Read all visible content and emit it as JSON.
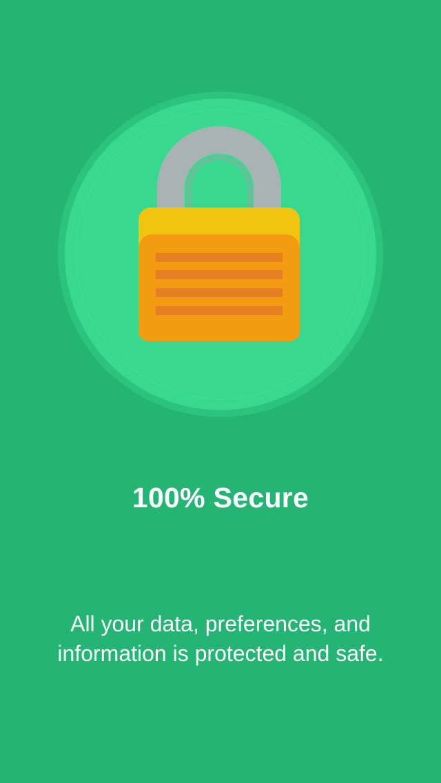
{
  "colors": {
    "background": "#24b574",
    "circle_outer": "#2cc27f",
    "circle_inner": "#38d98e",
    "shackle": "#a9b3b4",
    "lock_top": "#f1c40f",
    "lock_body": "#f39c12",
    "lock_stripes": "#e67e22",
    "text": "#ffffff"
  },
  "hero": {
    "icon": "padlock-icon"
  },
  "headline": "100% Secure",
  "description": {
    "line1": "All your data, preferences, and",
    "line2": "information is protected and safe."
  }
}
